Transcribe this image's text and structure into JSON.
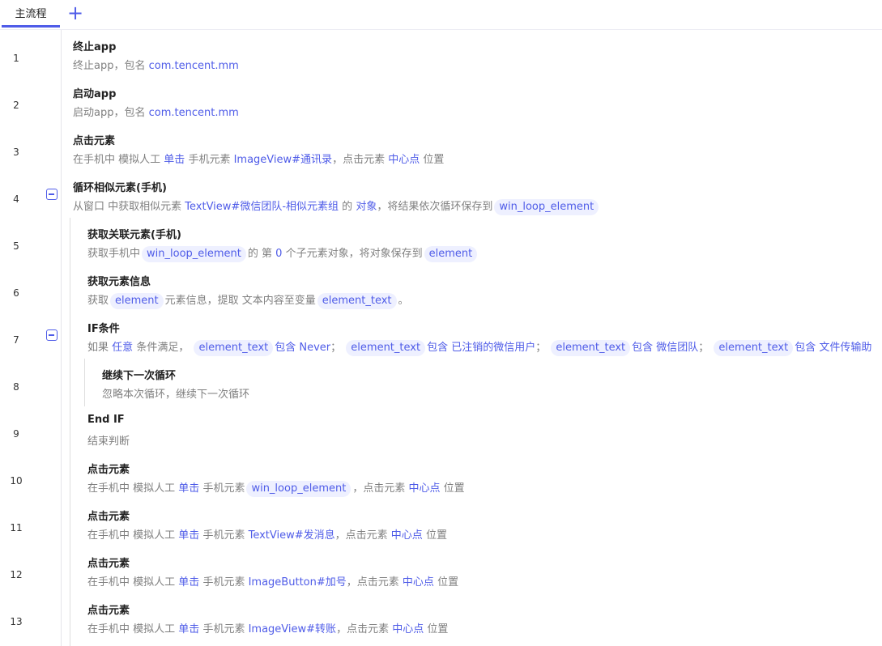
{
  "tab": {
    "main": "主流程"
  },
  "rows": [
    {
      "num": "1",
      "title": "终止app",
      "d1": "终止app，包名",
      "v1": "com.tencent.mm"
    },
    {
      "num": "2",
      "title": "启动app",
      "d1": "启动app，包名",
      "v1": "com.tencent.mm"
    },
    {
      "num": "3",
      "title": "点击元素",
      "d1": "在手机中 模拟人工",
      "l1": "单击",
      "d2": "手机元素",
      "l2": "ImageView#通讯录",
      "d3": "，点击元素",
      "l3": "中心点",
      "d4": "位置"
    },
    {
      "num": "4",
      "title": "循环相似元素(手机)",
      "d1": "从窗口 中获取相似元素",
      "l1": "TextView#微信团队-相似元素组",
      "d2": "的",
      "l2": "对象",
      "d3": "，将结果依次循环保存到",
      "c1": "win_loop_element"
    },
    {
      "num": "5",
      "title": "获取关联元素(手机)",
      "d1": "获取手机中",
      "c1": "win_loop_element",
      "d2": "的 第",
      "v1": "0",
      "d3": "个子元素对象，将对象保存到",
      "c2": "element"
    },
    {
      "num": "6",
      "title": "获取元素信息",
      "d1": "获取",
      "c1": "element",
      "d2": "元素信息，提取 文本内容至变量",
      "c2": "element_text",
      "d3": "。"
    },
    {
      "num": "7",
      "title": "IF条件",
      "d1": "如果",
      "l1": "任意",
      "d2": "条件满足，",
      "c1": "element_text",
      "p1": "包含 Never",
      "s1": "；",
      "c2": "element_text",
      "p2": "包含 已注销的微信用户",
      "s2": "；",
      "c3": "element_text",
      "p3": "包含 微信团队",
      "s3": "；",
      "c4": "element_text",
      "p4": "包含 文件传输助"
    },
    {
      "num": "8",
      "title": "继续下一次循环",
      "d1": "忽略本次循环，继续下一次循环"
    },
    {
      "num": "9",
      "title": "End IF",
      "d1": "结束判断"
    },
    {
      "num": "10",
      "title": "点击元素",
      "d1": "在手机中 模拟人工",
      "l1": "单击",
      "d2": "手机元素",
      "c1": "win_loop_element",
      "d3": "，点击元素",
      "l3": "中心点",
      "d4": "位置"
    },
    {
      "num": "11",
      "title": "点击元素",
      "d1": "在手机中 模拟人工",
      "l1": "单击",
      "d2": "手机元素",
      "l2": "TextView#发消息",
      "d3": "，点击元素",
      "l3": "中心点",
      "d4": "位置"
    },
    {
      "num": "12",
      "title": "点击元素",
      "d1": "在手机中 模拟人工",
      "l1": "单击",
      "d2": "手机元素",
      "l2": "ImageButton#加号",
      "d3": "，点击元素",
      "l3": "中心点",
      "d4": "位置"
    },
    {
      "num": "13",
      "title": "点击元素",
      "d1": "在手机中 模拟人工",
      "l1": "单击",
      "d2": "手机元素",
      "l2": "ImageView#转账",
      "d3": "，点击元素",
      "l3": "中心点",
      "d4": "位置"
    }
  ]
}
